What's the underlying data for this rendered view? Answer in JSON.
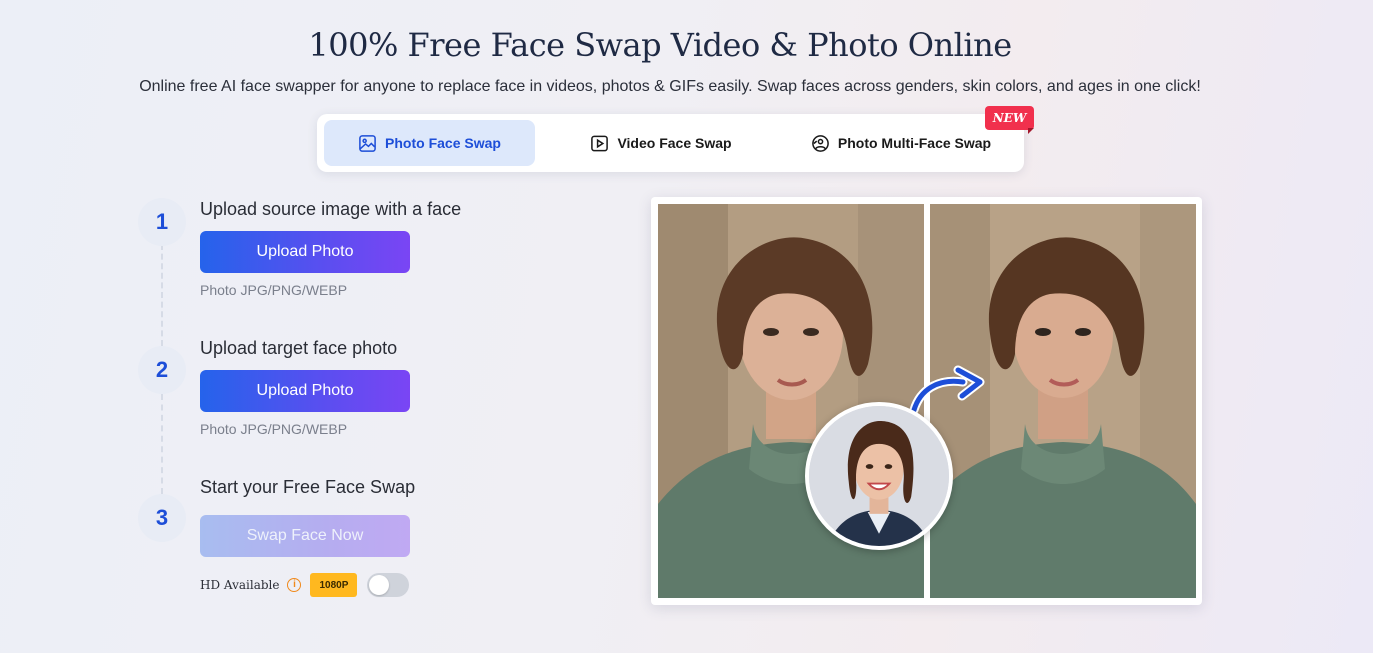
{
  "header": {
    "title": "100% Free Face Swap Video & Photo Online",
    "subtitle": "Online free AI face swapper for anyone to replace face in videos, photos & GIFs easily. Swap faces across genders, skin colors, and ages in one click!"
  },
  "tabs": [
    {
      "label": "Photo Face Swap",
      "icon": "image-icon",
      "active": true
    },
    {
      "label": "Video Face Swap",
      "icon": "play-icon",
      "active": false
    },
    {
      "label": "Photo Multi-Face Swap",
      "icon": "face-image-icon",
      "active": false
    }
  ],
  "new_badge": "NEW",
  "steps": [
    {
      "number": "1",
      "title": "Upload source image with a face",
      "button": "Upload Photo",
      "hint": "Photo JPG/PNG/WEBP"
    },
    {
      "number": "2",
      "title": "Upload target face photo",
      "button": "Upload Photo",
      "hint": "Photo JPG/PNG/WEBP"
    },
    {
      "number": "3",
      "title": "Start your Free Face Swap",
      "button": "Swap Face Now"
    }
  ],
  "hd": {
    "label": "HD Available",
    "info_icon": "info-icon",
    "info_glyph": "i",
    "resolution": "1080P",
    "enabled": false
  },
  "colors": {
    "accent": "#1d4ed8",
    "button_start": "#2563eb",
    "button_end": "#7a45f4",
    "badge_new": "#f1304d",
    "badge_resolution": "#ffb81f"
  }
}
